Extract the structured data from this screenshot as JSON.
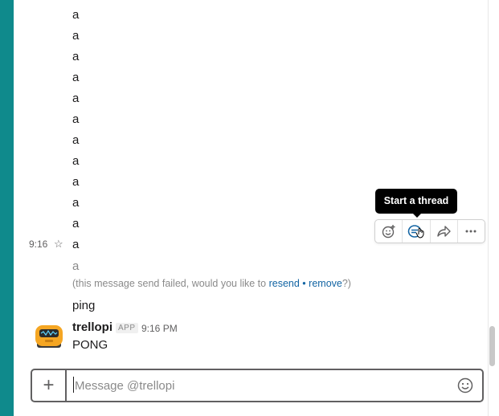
{
  "messages": {
    "lines": [
      "a",
      "a",
      "a",
      "a",
      "a",
      "a",
      "a",
      "a",
      "a",
      "a",
      "a",
      "a"
    ],
    "timestamp": "9:16",
    "failed_text": "a",
    "fail_note": {
      "prefix": "(this message send failed, would you like to ",
      "resend": "resend",
      "separator": "•",
      "remove": "remove",
      "suffix": "?)"
    },
    "ping": "ping",
    "bot": {
      "name": "trellopi",
      "badge": "APP",
      "time": "9:16 PM",
      "text": "PONG"
    }
  },
  "hover_actions": {
    "tooltip": "Start a thread",
    "icons": [
      "add-reaction-icon",
      "start-thread-icon",
      "share-icon",
      "more-icon"
    ]
  },
  "composer": {
    "placeholder": "Message @trellopi",
    "plus": "+"
  },
  "colors": {
    "sidebar": "#0f8a8c",
    "link": "#1264a3",
    "thread_icon": "#1264a3"
  }
}
